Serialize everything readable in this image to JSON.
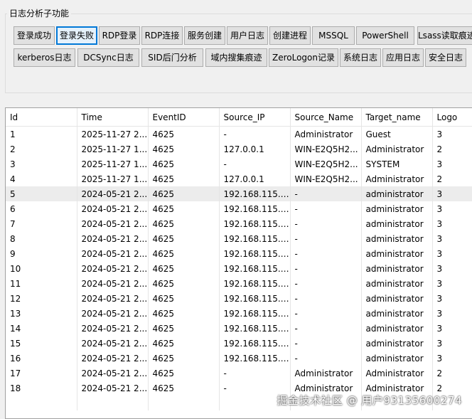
{
  "group_title": "日志分析子功能",
  "buttons_row1": [
    {
      "label": "登录成功",
      "active": false
    },
    {
      "label": "登录失败",
      "active": true
    },
    {
      "label": "RDP登录",
      "active": false
    },
    {
      "label": "RDP连接",
      "active": false
    },
    {
      "label": "服务创建",
      "active": false
    },
    {
      "label": "用户日志",
      "active": false
    },
    {
      "label": "创建进程",
      "active": false
    },
    {
      "label": "MSSQL",
      "active": false
    },
    {
      "label": "PowerShell",
      "active": false
    },
    {
      "label": "Lsass读取痕迹",
      "active": false
    }
  ],
  "buttons_row2": [
    {
      "label": "kerberos日志"
    },
    {
      "label": "DCSync日志"
    },
    {
      "label": "SID后门分析"
    },
    {
      "label": "域内搜集痕迹"
    },
    {
      "label": "ZeroLogon记录"
    },
    {
      "label": "系统日志"
    },
    {
      "label": "应用日志"
    },
    {
      "label": "安全日志"
    }
  ],
  "table": {
    "columns": [
      "Id",
      "Time",
      "EventID",
      "Source_IP",
      "Source_Name",
      "Target_name",
      "Logo"
    ],
    "selected_row": 4,
    "rows": [
      [
        "1",
        "2025-11-27 2...",
        "4625",
        "-",
        "Administrator",
        "Guest",
        "3"
      ],
      [
        "2",
        "2025-11-27 1...",
        "4625",
        "127.0.0.1",
        "WIN-E2Q5H2...",
        "Administrator",
        "2"
      ],
      [
        "3",
        "2025-11-27 1...",
        "4625",
        "-",
        "WIN-E2Q5H2...",
        "SYSTEM",
        "3"
      ],
      [
        "4",
        "2025-11-27 1...",
        "4625",
        "127.0.0.1",
        "WIN-E2Q5H2...",
        "Administrator",
        "2"
      ],
      [
        "5",
        "2024-05-21 2...",
        "4625",
        "192.168.115.1...",
        "-",
        "administrator",
        "3"
      ],
      [
        "6",
        "2024-05-21 2...",
        "4625",
        "192.168.115.1...",
        "-",
        "administrator",
        "3"
      ],
      [
        "7",
        "2024-05-21 2...",
        "4625",
        "192.168.115.1...",
        "-",
        "administrator",
        "3"
      ],
      [
        "8",
        "2024-05-21 2...",
        "4625",
        "192.168.115.1...",
        "-",
        "administrator",
        "3"
      ],
      [
        "9",
        "2024-05-21 2...",
        "4625",
        "192.168.115.1...",
        "-",
        "administrator",
        "3"
      ],
      [
        "10",
        "2024-05-21 2...",
        "4625",
        "192.168.115.1...",
        "-",
        "administrator",
        "3"
      ],
      [
        "11",
        "2024-05-21 2...",
        "4625",
        "192.168.115.1...",
        "-",
        "administrator",
        "3"
      ],
      [
        "12",
        "2024-05-21 2...",
        "4625",
        "192.168.115.1...",
        "-",
        "administrator",
        "3"
      ],
      [
        "13",
        "2024-05-21 2...",
        "4625",
        "192.168.115.1...",
        "-",
        "administrator",
        "3"
      ],
      [
        "14",
        "2024-05-21 2...",
        "4625",
        "192.168.115.1...",
        "-",
        "administrator",
        "3"
      ],
      [
        "15",
        "2024-05-21 2...",
        "4625",
        "192.168.115.1...",
        "-",
        "administrator",
        "3"
      ],
      [
        "16",
        "2024-05-21 2...",
        "4625",
        "192.168.115.1...",
        "-",
        "administrator",
        "3"
      ],
      [
        "17",
        "2024-05-21 2...",
        "4625",
        "-",
        "Administrator",
        "Administrator",
        "2"
      ],
      [
        "18",
        "2024-05-21 2...",
        "4625",
        "-",
        "Administrator",
        "Administrator",
        "2"
      ]
    ]
  },
  "watermark": "掘金技术社区 @ 用户9313560027​4",
  "colors": {
    "active_border": "#0078d7",
    "selected_row": "#ececec"
  }
}
